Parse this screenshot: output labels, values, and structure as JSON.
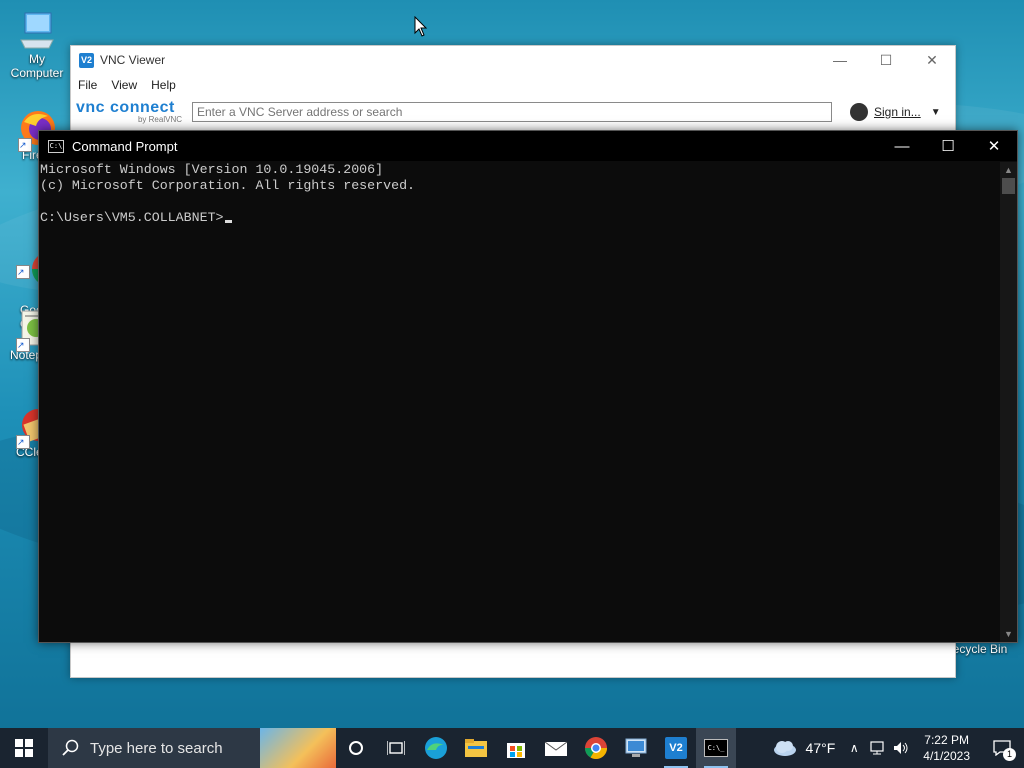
{
  "desktop": {
    "icons": [
      {
        "label": "My Computer",
        "icon": "computer-icon"
      },
      {
        "label": "Fire",
        "icon": "firefox-icon"
      },
      {
        "label": "Goo\nChro",
        "icon": "chrome-icon"
      },
      {
        "label": "Notep",
        "icon": "notepad-plus-icon"
      },
      {
        "label": "CCle",
        "icon": "ccleaner-icon"
      },
      {
        "label": "ecycle Bin",
        "icon": "recycle-bin-icon"
      }
    ]
  },
  "vnc": {
    "title": "VNC Viewer",
    "menu": [
      "File",
      "View",
      "Help"
    ],
    "brand_main": "vnc connect",
    "brand_sub": "by RealVNC",
    "search_placeholder": "Enter a VNC Server address or search",
    "signin_label": "Sign in..."
  },
  "cmd": {
    "title": "Command Prompt",
    "lines": [
      "Microsoft Windows [Version 10.0.19045.2006]",
      "(c) Microsoft Corporation. All rights reserved.",
      "",
      "C:\\Users\\VM5.COLLABNET>"
    ]
  },
  "taskbar": {
    "search_placeholder": "Type here to search",
    "weather_temp": "47°F",
    "time": "7:22 PM",
    "date": "4/1/2023",
    "notification_count": "1",
    "pinned": [
      "cortana-icon",
      "task-view-icon",
      "edge-icon",
      "file-explorer-icon",
      "store-icon",
      "mail-icon",
      "chrome-icon",
      "remote-desktop-icon",
      "vnc-viewer-icon",
      "command-prompt-icon"
    ]
  },
  "colors": {
    "cmd_bg": "#0c0c0c",
    "cmd_text": "#cccccc",
    "vnc_accent": "#1e7fd0",
    "taskbar_bg": "#1a2430"
  }
}
